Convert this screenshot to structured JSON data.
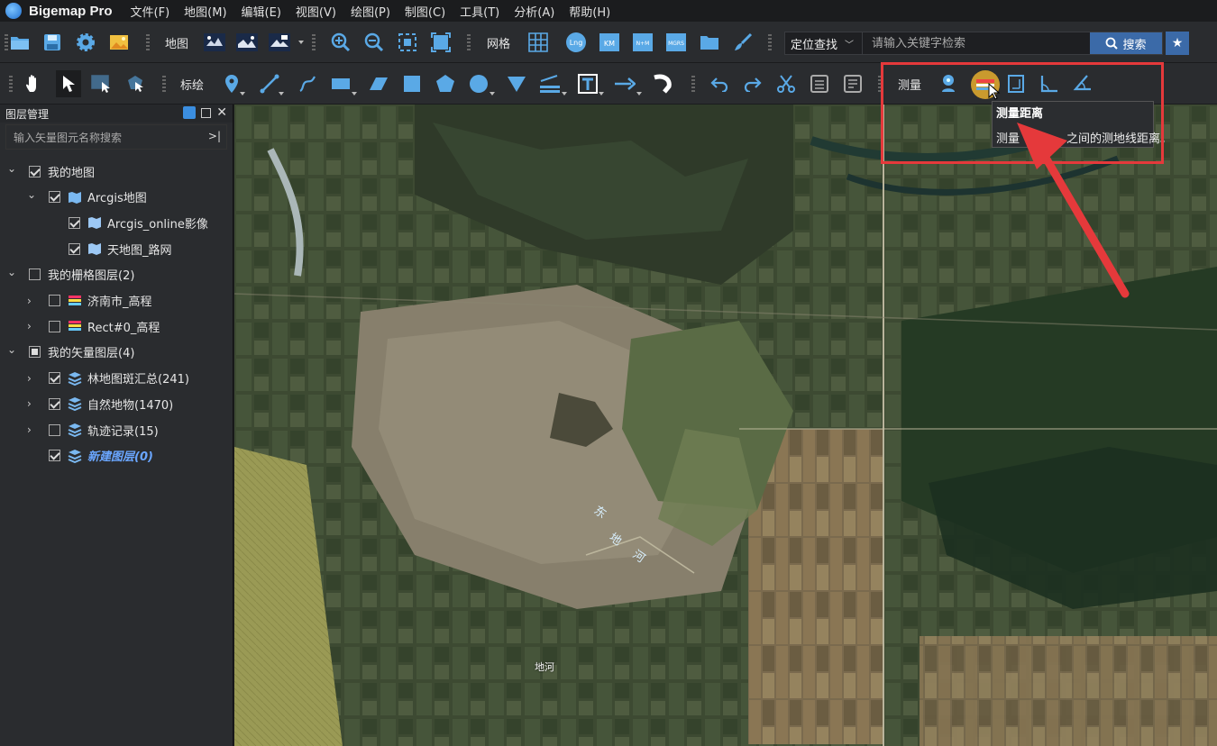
{
  "app": {
    "title": "Bigemap Pro"
  },
  "menu": [
    "文件(F)",
    "地图(M)",
    "编辑(E)",
    "视图(V)",
    "绘图(P)",
    "制图(C)",
    "工具(T)",
    "分析(A)",
    "帮助(H)"
  ],
  "toolbar1": {
    "map_label": "地图",
    "grid_label": "网格",
    "grid_icons": [
      "Lng",
      "KM",
      "N+M",
      "MGRS"
    ]
  },
  "search": {
    "mode": "定位查找",
    "placeholder": "请输入关键字检索",
    "button": "搜索"
  },
  "toolbar2": {
    "annotate_label": "标绘",
    "measure_label": "测量"
  },
  "tooltip": {
    "title": "测量距离",
    "desc_a": "测量",
    "desc_b": "之间的测地线距离。"
  },
  "panel": {
    "title": "图层管理",
    "search_placeholder": "输入矢量图元名称搜索",
    "tree": [
      {
        "label": "我的地图",
        "level": 0,
        "expanded": true,
        "check": "checked",
        "icon": "none"
      },
      {
        "label": "Arcgis地图",
        "level": 1,
        "expanded": true,
        "check": "checked",
        "icon": "map-folder"
      },
      {
        "label": "Arcgis_online影像",
        "level": 2,
        "expanded": null,
        "check": "checked",
        "icon": "map-layer"
      },
      {
        "label": "天地图_路网",
        "level": 2,
        "expanded": null,
        "check": "checked",
        "icon": "map-layer"
      },
      {
        "label": "我的栅格图层(2)",
        "level": 0,
        "expanded": true,
        "check": "unchecked",
        "icon": "none"
      },
      {
        "label": "济南市_高程",
        "level": 1,
        "expanded": false,
        "check": "unchecked",
        "icon": "raster"
      },
      {
        "label": "Rect#0_高程",
        "level": 1,
        "expanded": false,
        "check": "unchecked",
        "icon": "raster"
      },
      {
        "label": "我的矢量图层(4)",
        "level": 0,
        "expanded": true,
        "check": "partial",
        "icon": "none"
      },
      {
        "label": "林地图斑汇总(241)",
        "level": 1,
        "expanded": false,
        "check": "checked",
        "icon": "vector"
      },
      {
        "label": "自然地物(1470)",
        "level": 1,
        "expanded": false,
        "check": "checked",
        "icon": "vector"
      },
      {
        "label": "轨迹记录(15)",
        "level": 1,
        "expanded": false,
        "check": "unchecked",
        "icon": "vector"
      },
      {
        "label": "新建图层(0)",
        "level": 1,
        "expanded": null,
        "check": "checked",
        "icon": "vector",
        "active": true
      }
    ]
  },
  "map": {
    "labels": [
      "东",
      "地",
      "河",
      "地河"
    ]
  },
  "colors": {
    "accent": "#3b6aa8",
    "highlight": "#e5393b",
    "active_layer": "#6aa6ff"
  }
}
